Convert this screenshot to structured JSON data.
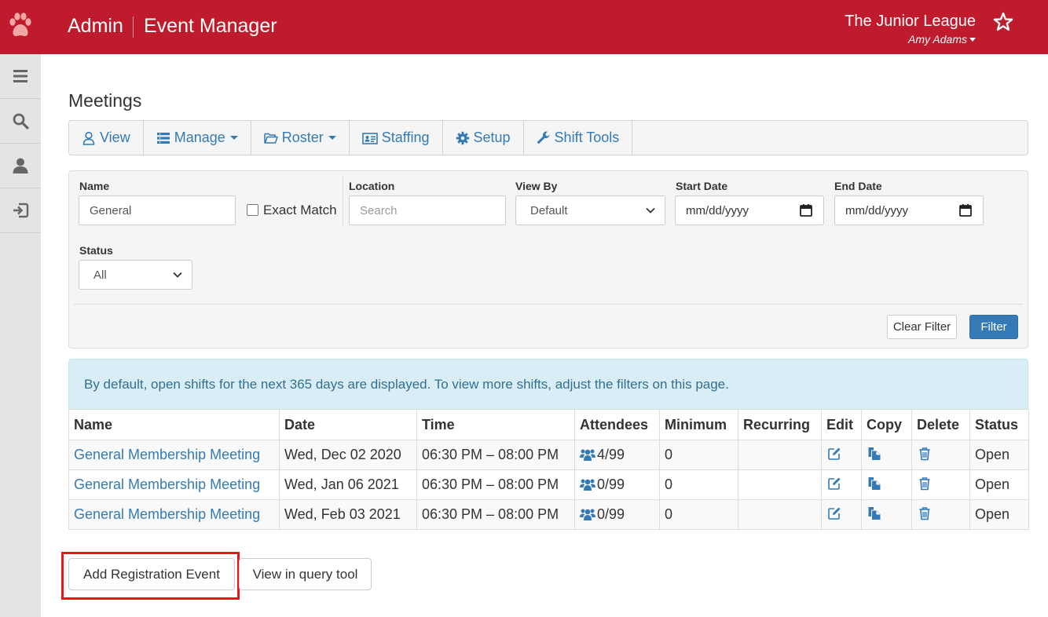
{
  "header": {
    "admin_label": "Admin",
    "app_title": "Event Manager",
    "org_name": "The Junior League",
    "user_name": "Amy Adams",
    "brand_color": "#c01b2c"
  },
  "sidebar": {
    "items": [
      {
        "icon": "menu-icon"
      },
      {
        "icon": "search-icon"
      },
      {
        "icon": "user-icon"
      },
      {
        "icon": "sign-in-icon"
      }
    ]
  },
  "page": {
    "title": "Meetings"
  },
  "tabs": [
    {
      "label": "View",
      "icon": "user-outline-icon"
    },
    {
      "label": "Manage",
      "icon": "list-icon",
      "dropdown": true
    },
    {
      "label": "Roster",
      "icon": "folder-open-icon",
      "dropdown": true
    },
    {
      "label": "Staffing",
      "icon": "id-card-icon"
    },
    {
      "label": "Setup",
      "icon": "gear-icon"
    },
    {
      "label": "Shift Tools",
      "icon": "wrench-icon"
    }
  ],
  "filters": {
    "name_label": "Name",
    "name_value": "General",
    "exact_match_label": "Exact Match",
    "exact_match_checked": false,
    "location_label": "Location",
    "location_placeholder": "Search",
    "view_by_label": "View By",
    "view_by_value": "Default",
    "start_date_label": "Start Date",
    "start_date_placeholder": "mm/dd/yyyy",
    "end_date_label": "End Date",
    "end_date_placeholder": "mm/dd/yyyy",
    "status_label": "Status",
    "status_value": "All",
    "clear_label": "Clear Filter",
    "filter_label": "Filter"
  },
  "alert": {
    "text": "By default, open shifts for the next 365 days are displayed. To view more shifts, adjust the filters on this page."
  },
  "table": {
    "columns": [
      "Name",
      "Date",
      "Time",
      "Attendees",
      "Minimum",
      "Recurring",
      "Edit",
      "Copy",
      "Delete",
      "Status"
    ],
    "rows": [
      {
        "name": "General Membership Meeting",
        "date": "Wed, Dec 02 2020",
        "time": "06:30 PM – 08:00 PM",
        "attendees": "4/99",
        "minimum": "0",
        "recurring": "",
        "status": "Open"
      },
      {
        "name": "General Membership Meeting",
        "date": "Wed, Jan 06 2021",
        "time": "06:30 PM – 08:00 PM",
        "attendees": "0/99",
        "minimum": "0",
        "recurring": "",
        "status": "Open"
      },
      {
        "name": "General Membership Meeting",
        "date": "Wed, Feb 03 2021",
        "time": "06:30 PM – 08:00 PM",
        "attendees": "0/99",
        "minimum": "0",
        "recurring": "",
        "status": "Open"
      }
    ]
  },
  "actions": {
    "add_registration_label": "Add Registration Event",
    "view_query_label": "View in query tool"
  },
  "colors": {
    "link": "#337ab7",
    "highlight": "#e8141a",
    "alert_bg": "#d9edf7",
    "primary": "#337ab7"
  }
}
